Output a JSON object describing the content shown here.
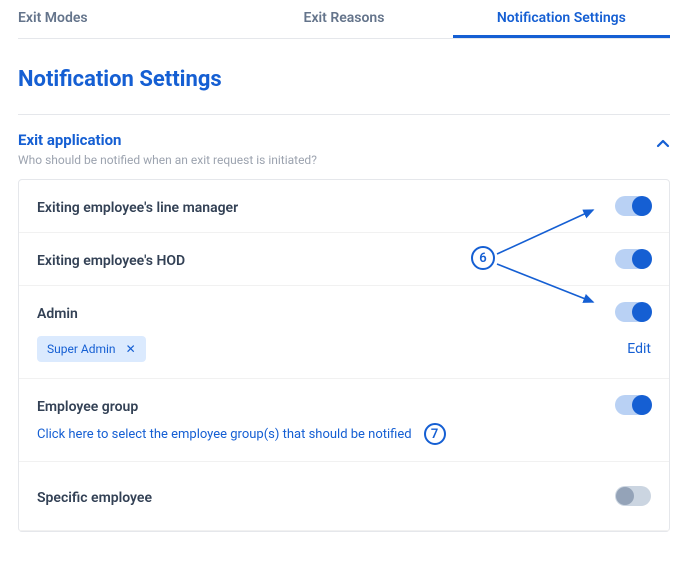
{
  "tabs": [
    {
      "label": "Exit Modes",
      "active": false
    },
    {
      "label": "Exit Reasons",
      "active": false
    },
    {
      "label": "Notification Settings",
      "active": true
    }
  ],
  "page_title": "Notification Settings",
  "section": {
    "title": "Exit application",
    "subtitle": "Who should be notified when an exit request is initiated?"
  },
  "rows": {
    "line_manager": {
      "label": "Exiting employee's line manager",
      "on": true
    },
    "hod": {
      "label": "Exiting employee's HOD",
      "on": true
    },
    "admin": {
      "label": "Admin",
      "on": true,
      "chip": "Super Admin",
      "edit": "Edit"
    },
    "group": {
      "label": "Employee group",
      "on": true,
      "sublink": "Click here to select the employee group(s) that should be notified"
    },
    "specific": {
      "label": "Specific employee",
      "on": false
    }
  },
  "annotations": {
    "six": "6",
    "seven": "7"
  }
}
